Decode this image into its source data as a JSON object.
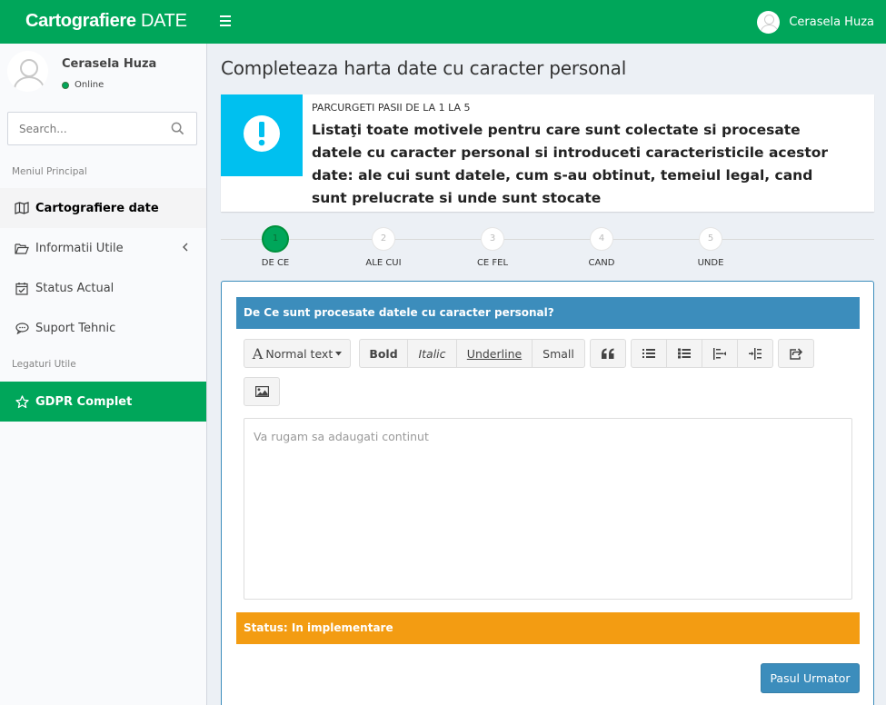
{
  "header": {
    "brand_bold": "Cartografiere",
    "brand_light": " DATE",
    "user_name": "Cerasela Huza"
  },
  "sidebar": {
    "user": {
      "name": "Cerasela Huza",
      "status": "Online"
    },
    "search": {
      "placeholder": "Search..."
    },
    "section_main": "Meniul Principal",
    "items": [
      {
        "label": "Cartografiere date",
        "icon": "map-icon"
      },
      {
        "label": "Informatii Utile",
        "icon": "folder-open-icon"
      },
      {
        "label": "Status Actual",
        "icon": "calendar-check-icon"
      },
      {
        "label": "Suport Tehnic",
        "icon": "comment-icon"
      }
    ],
    "section_links": "Legaturi Utile",
    "gdpr": {
      "label": "GDPR Complet",
      "icon": "star-icon"
    }
  },
  "page": {
    "title": "Completeaza harta date cu caracter personal"
  },
  "info_box": {
    "icon": "exclamation-icon",
    "subtitle": "Parcurgeti pasii de la 1 la 5",
    "text": "Listaţi toate motivele pentru care sunt colectate si procesate datele cu caracter personal si introduceti caracteristicile acestor date: ale cui sunt datele, cum s-au obtinut, temeiul legal, cand sunt prelucrate si unde sunt stocate"
  },
  "steps": [
    {
      "num": "1",
      "label": "De Ce"
    },
    {
      "num": "2",
      "label": "Ale Cui"
    },
    {
      "num": "3",
      "label": "Ce Fel"
    },
    {
      "num": "4",
      "label": "Cand"
    },
    {
      "num": "5",
      "label": "Unde"
    }
  ],
  "form": {
    "question": "De Ce sunt procesate datele cu caracter personal?",
    "toolbar": {
      "normal_text": "Normal text",
      "bold": "Bold",
      "italic": "Italic",
      "underline": "Underline",
      "small": "Small"
    },
    "editor_placeholder": "Va rugam sa adaugati continut",
    "editor_value": "",
    "status": "Status: In implementare",
    "next_button": "Pasul Urmator"
  },
  "colors": {
    "brand_green": "#00a65a",
    "primary_blue": "#3c8dbc",
    "info_cyan": "#00c0ef",
    "warning_orange": "#f39c12"
  }
}
